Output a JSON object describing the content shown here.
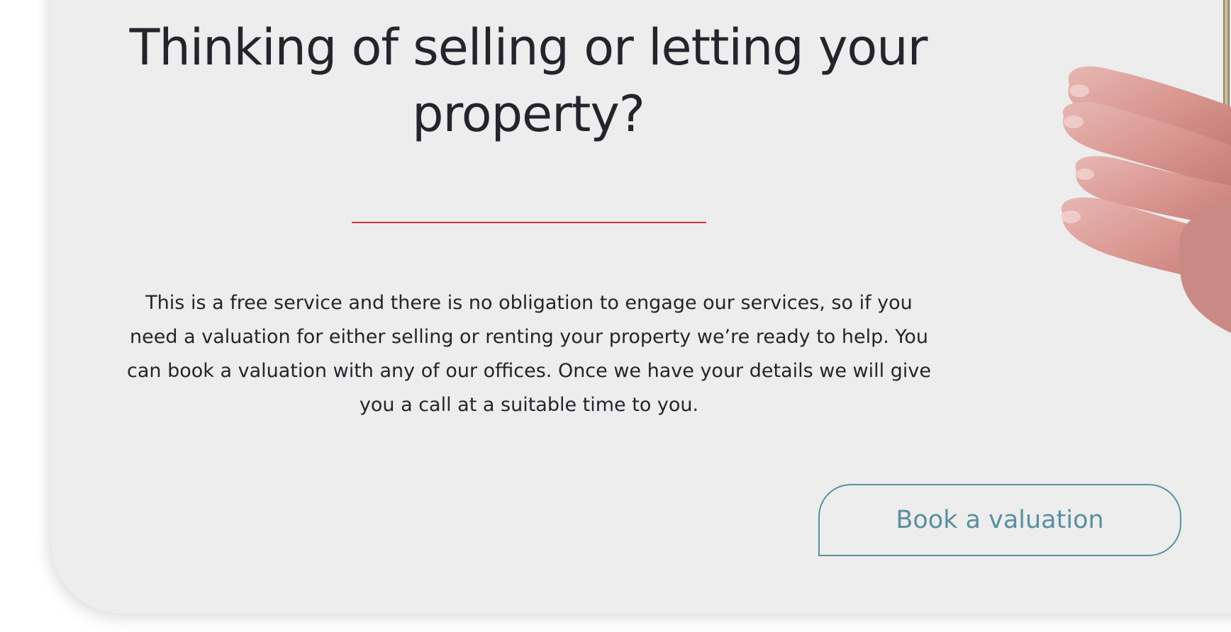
{
  "section": {
    "heading": "Thinking of selling or letting your property?",
    "body": "This is a free service and there is no obligation to engage our services, so if you need a valuation for either selling or renting your property we’re ready to help. You can book a valuation with any of our offices. Once we have your details we will give you a call at a suitable time to you.",
    "cta_label": "Book a valuation"
  },
  "colors": {
    "background": "#ffffff",
    "card": "#ededed",
    "heading_text": "#23252b",
    "divider": "#d4363b",
    "cta_accent": "#5a8fa1",
    "skin": "#dfa39f"
  },
  "icons": {
    "hand": "hand-holding-keys-photo"
  }
}
